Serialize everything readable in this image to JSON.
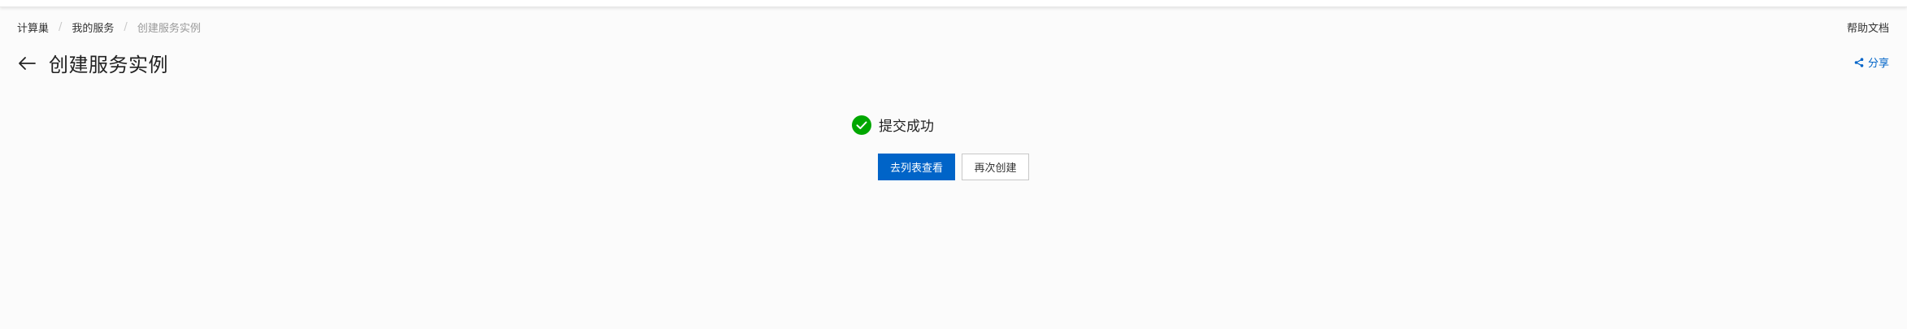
{
  "breadcrumb": {
    "items": [
      "计算巢",
      "我的服务",
      "创建服务实例"
    ],
    "separator": "/"
  },
  "header": {
    "title": "创建服务实例",
    "help_label": "帮助文档",
    "share_label": "分享",
    "back_icon": "arrow-left-icon",
    "share_icon": "share-icon"
  },
  "result": {
    "status": "success",
    "message": "提交成功",
    "icon": "check-circle-icon",
    "icon_color": "#00a700"
  },
  "actions": {
    "primary_label": "去列表查看",
    "secondary_label": "再次创建"
  },
  "colors": {
    "accent": "#0064c8",
    "success": "#00a700",
    "background": "#fbfbfb"
  }
}
